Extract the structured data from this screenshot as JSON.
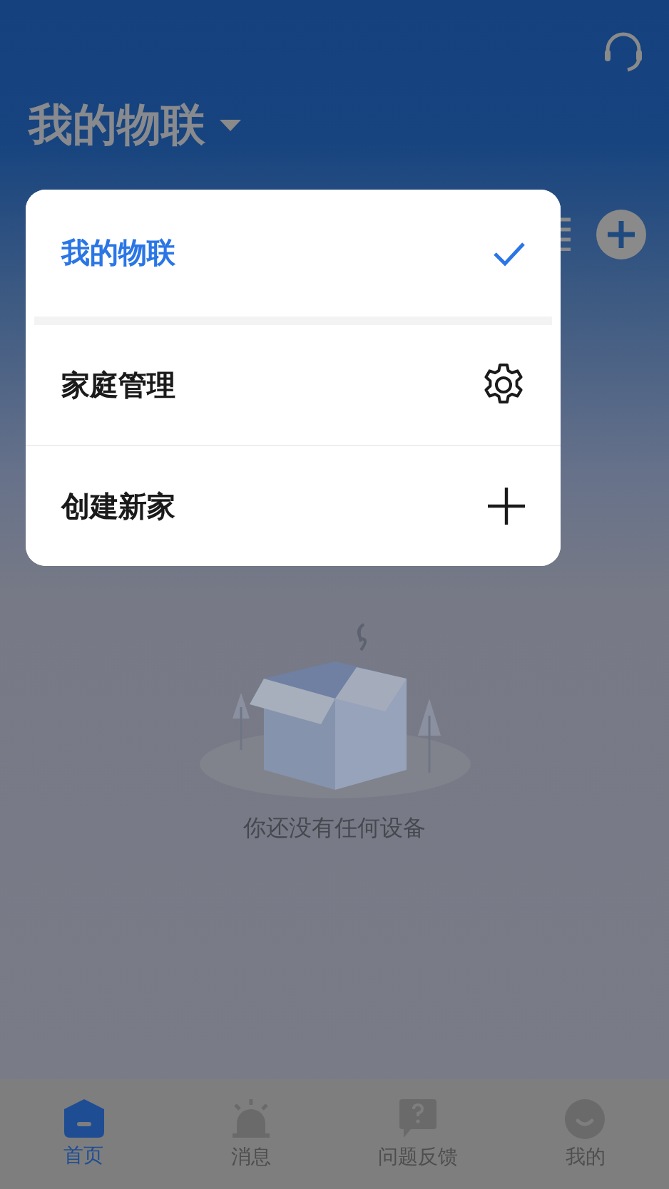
{
  "header": {
    "title": "我的物联"
  },
  "menu": {
    "items": [
      {
        "label": "我的物联",
        "selected": true,
        "kind": "check"
      },
      {
        "label": "家庭管理",
        "selected": false,
        "kind": "gear"
      },
      {
        "label": "创建新家",
        "selected": false,
        "kind": "plus"
      }
    ]
  },
  "empty_state": {
    "message": "你还没有任何设备"
  },
  "tab_bar": {
    "tabs": [
      {
        "label": "首页",
        "selected": true,
        "kind": "home"
      },
      {
        "label": "消息",
        "selected": false,
        "kind": "alarm"
      },
      {
        "label": "问题反馈",
        "selected": false,
        "kind": "question"
      },
      {
        "label": "我的",
        "selected": false,
        "kind": "face"
      }
    ]
  }
}
